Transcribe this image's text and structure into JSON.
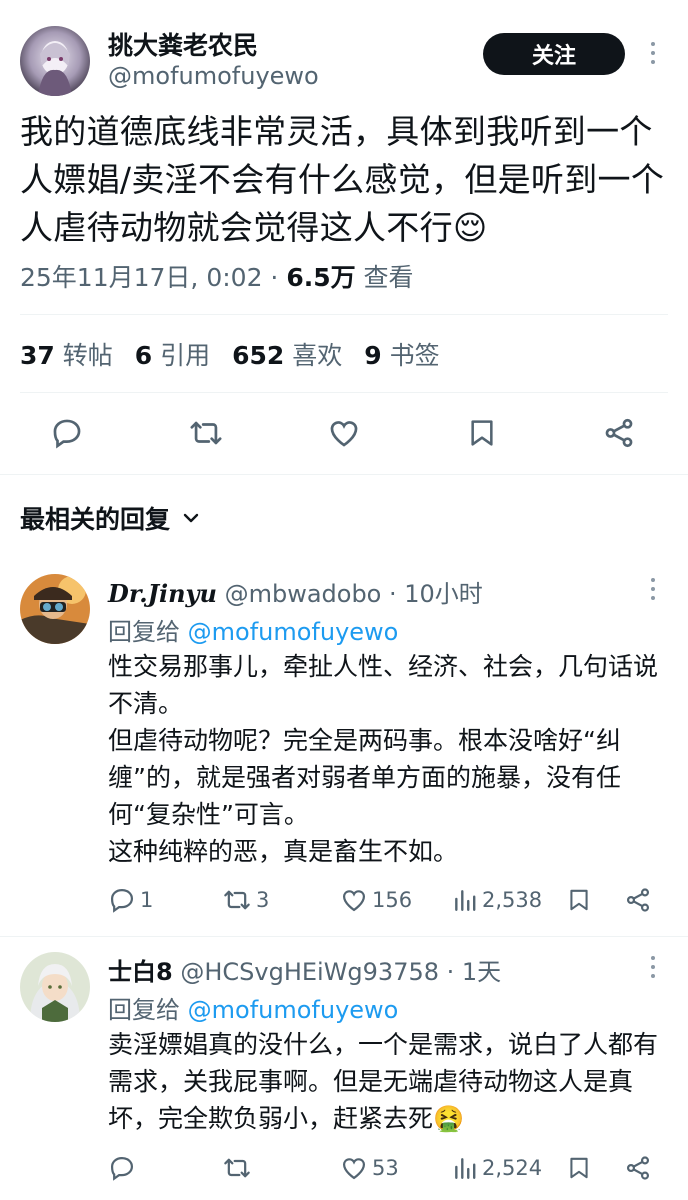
{
  "post": {
    "author_name": "挑大粪老农民",
    "handle": "@mofumofuyewo",
    "follow_label": "关注",
    "text": "我的道德底线非常灵活，具体到我听到一个人嫖娼/卖淫不会有什么感觉，但是听到一个人虐待动物就会觉得这人不行",
    "emoji": "😌",
    "timestamp": "25年11月17日, 0:02 · ",
    "views": "6.5万",
    "views_label": " 查看",
    "stats": [
      {
        "count": "37",
        "label": " 转帖"
      },
      {
        "count": "6",
        "label": " 引用"
      },
      {
        "count": "652",
        "label": " 喜欢"
      },
      {
        "count": "9",
        "label": " 书签"
      }
    ]
  },
  "replies_section": {
    "title": "最相关的回复"
  },
  "replies": [
    {
      "display_name": "Dr.Jinyu",
      "handle": "@mbwadobo",
      "time": " · 10小时",
      "reply_to_label": "回复给 ",
      "reply_to_handle": "@mofumofuyewo",
      "text": "性交易那事儿，牵扯人性、经济、社会，几句话说不清。\n但虐待动物呢？完全是两码事。根本没啥好“纠缠”的，就是强者对弱者单方面的施暴，没有任何“复杂性”可言。\n这种纯粹的恶，真是畜生不如。",
      "replies_count": "1",
      "retweets": "3",
      "likes": "156",
      "views": "2,538"
    },
    {
      "display_name": "士白8",
      "handle": "@HCSvgHEiWg93758",
      "time": " · 1天",
      "reply_to_label": "回复给 ",
      "reply_to_handle": "@mofumofuyewo",
      "text": "卖淫嫖娼真的没什么，一个是需求，说白了人都有需求，关我屁事啊。但是无端虐待动物这人是真坏，完全欺负弱小，赶紧去死",
      "emoji": "🤮",
      "replies_count": "",
      "retweets": "",
      "likes": "53",
      "views": "2,524"
    }
  ],
  "colors": {
    "text": "#0f1419",
    "muted": "#536471",
    "link": "#1d9bf0",
    "divider": "#eff3f4"
  }
}
